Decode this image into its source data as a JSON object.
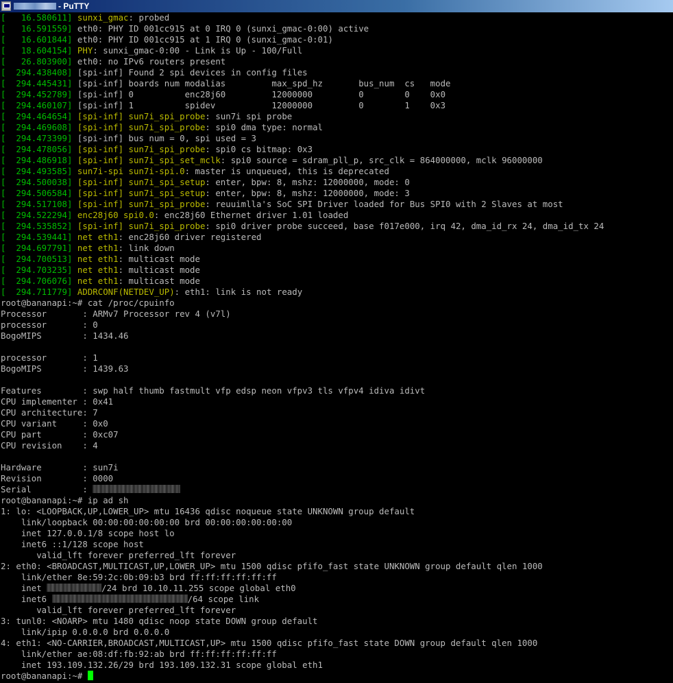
{
  "window": {
    "title": "- PuTTY"
  },
  "colors": {
    "background": "#000000",
    "text": "#bbbbbb",
    "timestamp": "#00bb00",
    "function": "#bbbb00",
    "cursor": "#00ff00"
  },
  "terminal": {
    "kernel_log": [
      {
        "ts": "   16.580611",
        "fn": "sunxi_gmac",
        "rest": ": probed"
      },
      {
        "ts": "   16.591559",
        "fn": "",
        "rest": "eth0: PHY ID 001cc915 at 0 IRQ 0 (sunxi_gmac-0:00) active"
      },
      {
        "ts": "   16.601844",
        "fn": "",
        "rest": "eth0: PHY ID 001cc915 at 1 IRQ 0 (sunxi_gmac-0:01)"
      },
      {
        "ts": "   18.604154",
        "fn": "PHY",
        "rest": ": sunxi_gmac-0:00 - Link is Up - 100/Full"
      },
      {
        "ts": "   26.803900",
        "fn": "",
        "rest": "eth0: no IPv6 routers present"
      },
      {
        "ts": "  294.438408",
        "fn": "",
        "rest": "[spi-inf] Found 2 spi devices in config files"
      },
      {
        "ts": "  294.445431",
        "fn": "",
        "rest": "[spi-inf] boards num modalias         max_spd_hz       bus_num  cs   mode"
      },
      {
        "ts": "  294.452789",
        "fn": "",
        "rest": "[spi-inf] 0          enc28j60         12000000         0        0    0x0"
      },
      {
        "ts": "  294.460107",
        "fn": "",
        "rest": "[spi-inf] 1          spidev           12000000         0        1    0x3"
      },
      {
        "ts": "  294.464654",
        "fn": "[spi-inf] sun7i_spi_probe",
        "rest": ": sun7i spi probe"
      },
      {
        "ts": "  294.469608",
        "fn": "[spi-inf] sun7i_spi_probe",
        "rest": ": spi0 dma type: normal"
      },
      {
        "ts": "  294.473399",
        "fn": "",
        "rest": "[spi-inf] bus num = 0, spi used = 3"
      },
      {
        "ts": "  294.478056",
        "fn": "[spi-inf] sun7i_spi_probe",
        "rest": ": spi0 cs bitmap: 0x3"
      },
      {
        "ts": "  294.486918",
        "fn": "[spi-inf] sun7i_spi_set_mclk",
        "rest": ": spi0 source = sdram_pll_p, src_clk = 864000000, mclk 96000000"
      },
      {
        "ts": "  294.493585",
        "fn": "sun7i-spi sun7i-spi.0",
        "rest": ": master is unqueued, this is deprecated"
      },
      {
        "ts": "  294.500038",
        "fn": "[spi-inf] sun7i_spi_setup",
        "rest": ": enter, bpw: 8, mshz: 12000000, mode: 0"
      },
      {
        "ts": "  294.506584",
        "fn": "[spi-inf] sun7i_spi_setup",
        "rest": ": enter, bpw: 8, mshz: 12000000, mode: 3"
      },
      {
        "ts": "  294.517108",
        "fn": "[spi-inf] sun7i_spi_probe",
        "rest": ": reuuimlla's SoC SPI Driver loaded for Bus SPI0 with 2 Slaves at most"
      },
      {
        "ts": "  294.522294",
        "fn": "enc28j60 spi0.0",
        "rest": ": enc28j60 Ethernet driver 1.01 loaded"
      },
      {
        "ts": "  294.535852",
        "fn": "[spi-inf] sun7i_spi_probe",
        "rest": ": spi0 driver probe succeed, base f017e000, irq 42, dma_id_rx 24, dma_id_tx 24"
      },
      {
        "ts": "  294.539441",
        "fn": "net eth1",
        "rest": ": enc28j60 driver registered"
      },
      {
        "ts": "  294.697791",
        "fn": "net eth1",
        "rest": ": link down"
      },
      {
        "ts": "  294.700513",
        "fn": "net eth1",
        "rest": ": multicast mode"
      },
      {
        "ts": "  294.703235",
        "fn": "net eth1",
        "rest": ": multicast mode"
      },
      {
        "ts": "  294.706076",
        "fn": "net eth1",
        "rest": ": multicast mode"
      },
      {
        "ts": "  294.711779",
        "fn": "ADDRCONF(NETDEV_UP)",
        "rest": ": eth1: link is not ready"
      }
    ],
    "cpuinfo_prompt": "root@bananapi:~# cat /proc/cpuinfo",
    "cpuinfo": [
      "Processor       : ARMv7 Processor rev 4 (v7l)",
      "processor       : 0",
      "BogoMIPS        : 1434.46",
      "",
      "processor       : 1",
      "BogoMIPS        : 1439.63",
      "",
      "Features        : swp half thumb fastmult vfp edsp neon vfpv3 tls vfpv4 idiva idivt",
      "CPU implementer : 0x41",
      "CPU architecture: 7",
      "CPU variant     : 0x0",
      "CPU part        : 0xc07",
      "CPU revision    : 4",
      "",
      "Hardware        : sun7i",
      "Revision        : 0000"
    ],
    "serial_label": "Serial          : ",
    "ip_prompt": "root@bananapi:~# ip ad sh",
    "ip_output_a": [
      "1: lo: <LOOPBACK,UP,LOWER_UP> mtu 16436 qdisc noqueue state UNKNOWN group default",
      "    link/loopback 00:00:00:00:00:00 brd 00:00:00:00:00:00",
      "    inet 127.0.0.1/8 scope host lo",
      "    inet6 ::1/128 scope host",
      "       valid_lft forever preferred_lft forever",
      "2: eth0: <BROADCAST,MULTICAST,UP,LOWER_UP> mtu 1500 qdisc pfifo_fast state UNKNOWN group default qlen 1000",
      "    link/ether 8e:59:2c:0b:09:b3 brd ff:ff:ff:ff:ff:ff"
    ],
    "eth0_inet_prefix": "    inet ",
    "eth0_inet_suffix": "/24 brd 10.10.11.255 scope global eth0",
    "eth0_inet6_prefix": "    inet6 ",
    "eth0_inet6_suffix": "/64 scope link",
    "ip_output_b": [
      "       valid_lft forever preferred_lft forever",
      "3: tunl0: <NOARP> mtu 1480 qdisc noop state DOWN group default",
      "    link/ipip 0.0.0.0 brd 0.0.0.0",
      "4: eth1: <NO-CARRIER,BROADCAST,MULTICAST,UP> mtu 1500 qdisc pfifo_fast state DOWN group default qlen 1000",
      "    link/ether ae:08:df:fb:92:ab brd ff:ff:ff:ff:ff:ff",
      "    inet 193.109.132.26/29 brd 193.109.132.31 scope global eth1"
    ],
    "final_prompt": "root@bananapi:~# "
  }
}
